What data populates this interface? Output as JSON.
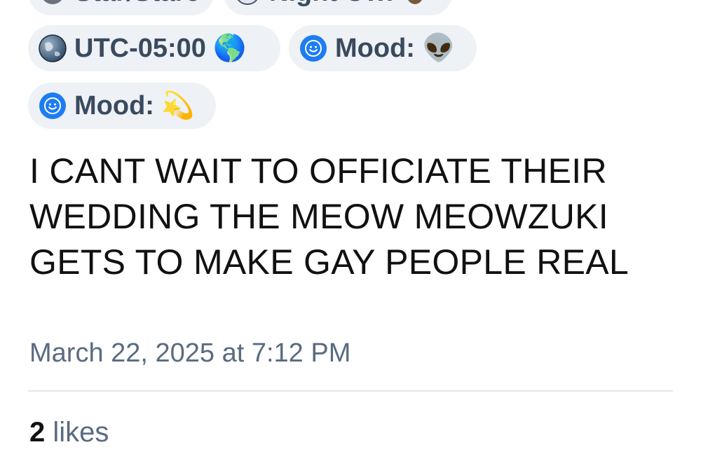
{
  "profile_chips": [
    {
      "label": "Star/Stare",
      "icon": "gray-circle-icon",
      "emoji": ""
    },
    {
      "label": "Night Owl",
      "icon": "moon-clock-icon",
      "emoji": "owl-emoji"
    }
  ],
  "utc_chip": {
    "label": "UTC-05:00",
    "icon": "earth-icon",
    "emoji": "🌎"
  },
  "mood_chips": [
    {
      "label": "Mood:",
      "icon": "smiley-bubble-icon",
      "emoji": "👽"
    },
    {
      "label": "Mood:",
      "icon": "smiley-bubble-icon",
      "emoji": "💫"
    }
  ],
  "post": {
    "text": "I CANT WAIT TO OFFICIATE THEIR\nWEDDING THE MEOW MEOWZUKI\nGETS TO MAKE GAY PEOPLE REAL",
    "timestamp": "March 22, 2025 at 7:12 PM"
  },
  "likes": {
    "count": "2",
    "label": "likes"
  },
  "colors": {
    "chip_bg": "#eef1f5",
    "chip_text": "#3a4a5e",
    "meta_text": "#5a6b80",
    "mood_icon_blue": "#1d7cf2"
  }
}
